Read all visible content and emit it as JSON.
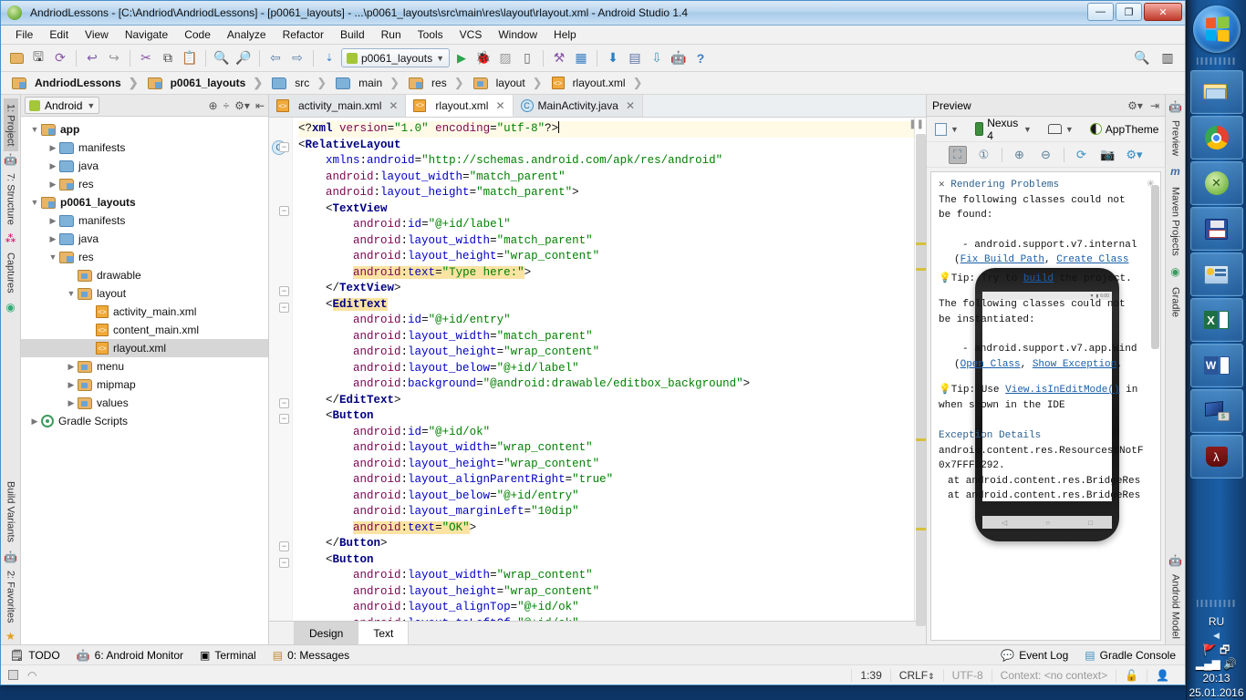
{
  "window": {
    "title": "AndriodLessons - [C:\\Andriod\\AndriodLessons] - [p0061_layouts] - ...\\p0061_layouts\\src\\main\\res\\layout\\rlayout.xml - Android Studio 1.4",
    "minimize": "—",
    "maximize": "❐",
    "close": "✕"
  },
  "menubar": [
    "File",
    "Edit",
    "View",
    "Navigate",
    "Code",
    "Analyze",
    "Refactor",
    "Build",
    "Run",
    "Tools",
    "VCS",
    "Window",
    "Help"
  ],
  "toolbar": {
    "run_config": "p0061_layouts",
    "help_label": "?"
  },
  "breadcrumb": [
    "AndriodLessons",
    "p0061_layouts",
    "src",
    "main",
    "res",
    "layout",
    "rlayout.xml"
  ],
  "left_rail": [
    "1: Project",
    "7: Structure",
    "Captures",
    "Build Variants",
    "2: Favorites"
  ],
  "right_rail": [
    "Preview",
    "Maven Projects",
    "Gradle",
    "Android Model"
  ],
  "project": {
    "selector": "Android",
    "tree": [
      {
        "label": "app",
        "depth": 0,
        "arrow": "▼",
        "icon": "module",
        "bold": true
      },
      {
        "label": "manifests",
        "depth": 1,
        "arrow": "▶",
        "icon": "folder-blue"
      },
      {
        "label": "java",
        "depth": 1,
        "arrow": "▶",
        "icon": "folder-blue"
      },
      {
        "label": "res",
        "depth": 1,
        "arrow": "▶",
        "icon": "folder-res"
      },
      {
        "label": "p0061_layouts",
        "depth": 0,
        "arrow": "▼",
        "icon": "module",
        "bold": true
      },
      {
        "label": "manifests",
        "depth": 1,
        "arrow": "▶",
        "icon": "folder-blue"
      },
      {
        "label": "java",
        "depth": 1,
        "arrow": "▶",
        "icon": "folder-blue"
      },
      {
        "label": "res",
        "depth": 1,
        "arrow": "▼",
        "icon": "folder-res"
      },
      {
        "label": "drawable",
        "depth": 2,
        "arrow": "",
        "icon": "folder-open"
      },
      {
        "label": "layout",
        "depth": 2,
        "arrow": "▼",
        "icon": "folder-open"
      },
      {
        "label": "activity_main.xml",
        "depth": 3,
        "arrow": "",
        "icon": "xml"
      },
      {
        "label": "content_main.xml",
        "depth": 3,
        "arrow": "",
        "icon": "xml"
      },
      {
        "label": "rlayout.xml",
        "depth": 3,
        "arrow": "",
        "icon": "xml",
        "selected": true
      },
      {
        "label": "menu",
        "depth": 2,
        "arrow": "▶",
        "icon": "folder-open"
      },
      {
        "label": "mipmap",
        "depth": 2,
        "arrow": "▶",
        "icon": "folder-open"
      },
      {
        "label": "values",
        "depth": 2,
        "arrow": "▶",
        "icon": "folder-open"
      },
      {
        "label": "Gradle Scripts",
        "depth": 0,
        "arrow": "▶",
        "icon": "gradle"
      }
    ]
  },
  "editor": {
    "tabs": [
      {
        "label": "activity_main.xml",
        "icon": "xml",
        "active": false,
        "close": "✕"
      },
      {
        "label": "rlayout.xml",
        "icon": "xml",
        "active": true,
        "close": "✕"
      },
      {
        "label": "MainActivity.java",
        "icon": "java",
        "active": false,
        "close": "✕"
      }
    ],
    "bottom_tabs": [
      {
        "label": "Design",
        "active": true
      },
      {
        "label": "Text",
        "active": false
      }
    ],
    "code_text": "<?xml version=\"1.0\" encoding=\"utf-8\"?>\n<RelativeLayout\n    xmlns:android=\"http://schemas.android.com/apk/res/android\"\n    android:layout_width=\"match_parent\"\n    android:layout_height=\"match_parent\">\n    <TextView\n        android:id=\"@+id/label\"\n        android:layout_width=\"match_parent\"\n        android:layout_height=\"wrap_content\"\n        android:text=\"Type here:\">\n    </TextView>\n    <EditText\n        android:id=\"@+id/entry\"\n        android:layout_width=\"match_parent\"\n        android:layout_height=\"wrap_content\"\n        android:layout_below=\"@+id/label\"\n        android:background=\"@android:drawable/editbox_background\">\n    </EditText>\n    <Button\n        android:id=\"@+id/ok\"\n        android:layout_width=\"wrap_content\"\n        android:layout_height=\"wrap_content\"\n        android:layout_alignParentRight=\"true\"\n        android:layout_below=\"@+id/entry\"\n        android:layout_marginLeft=\"10dip\"\n        android:text=\"OK\">\n    </Button>\n    <Button\n        android:layout_width=\"wrap_content\"\n        android:layout_height=\"wrap_content\"\n        android:layout_alignTop=\"@+id/ok\"\n        android:layout_toLeftOf=\"@+id/ok\"\n        android:text=\"Cancel\">"
  },
  "preview": {
    "title": "Preview",
    "device": "Nexus 4",
    "theme": "AppTheme",
    "overflow": "»",
    "problems": {
      "close": "✕",
      "title": "Rendering Problems",
      "line1": "The following classes could not",
      "line2": "be found:",
      "class1": "- android.support.v7.internal",
      "links1_a": "Fix Build Path",
      "links1_b": "Create Class",
      "tip1_pre": "Tip: Try to ",
      "tip1_link": "build",
      "tip1_post": " the project.",
      "line3": "The following classes could not",
      "line4": "be instantiated:",
      "class2": "- android.support.v7.app.Wind",
      "links2_a": "Open Class",
      "links2_b": "Show Exception",
      "tip2_pre": "Tip: Use ",
      "tip2_link": "View.isInEditMode()",
      "tip2_post": " in",
      "tip2_line2": "when shown in the IDE",
      "exc_title": "Exception Details",
      "exc1": "android.content.res.Resources$NotF",
      "exc2": "0x7FFF0292.",
      "exc3": "at android.content.res.BridgeRes",
      "exc4": "at android.content.res.BridgeRes"
    },
    "phone_clock": "6:00"
  },
  "messagebar": {
    "items": [
      {
        "label": "TODO",
        "icon": "todo-icon"
      },
      {
        "label": "6: Android Monitor",
        "icon": "android-icon",
        "mnemonic": "6"
      },
      {
        "label": "Terminal",
        "icon": "terminal-icon"
      },
      {
        "label": "0: Messages",
        "icon": "messages-icon",
        "mnemonic": "0"
      }
    ],
    "right": [
      {
        "label": "Event Log",
        "icon": "eventlog-icon"
      },
      {
        "label": "Gradle Console",
        "icon": "gradle-console-icon"
      }
    ]
  },
  "statusbar": {
    "caret": "1:39",
    "line_sep": "CRLF",
    "encoding": "UTF-8",
    "context": "Context: <no context>"
  },
  "taskbar": {
    "lang": "RU",
    "time": "20:13",
    "date": "25.01.2016",
    "apps": [
      {
        "name": "explorer",
        "glyph": "🗂"
      },
      {
        "name": "chrome",
        "glyph": "◉"
      },
      {
        "name": "android-studio",
        "glyph": "◈"
      },
      {
        "name": "save-app",
        "glyph": "💾"
      },
      {
        "name": "control-panel",
        "glyph": "🖥"
      },
      {
        "name": "excel",
        "glyph": "X"
      },
      {
        "name": "word",
        "glyph": "W"
      },
      {
        "name": "remote-desktop",
        "glyph": "🖵"
      },
      {
        "name": "acrobat",
        "glyph": "A"
      }
    ]
  },
  "colors": {
    "accent": "#3b78b0",
    "tag": "#000080",
    "attr": "#7d0552",
    "value": "#008000",
    "highlight": "#fbe3a3"
  }
}
